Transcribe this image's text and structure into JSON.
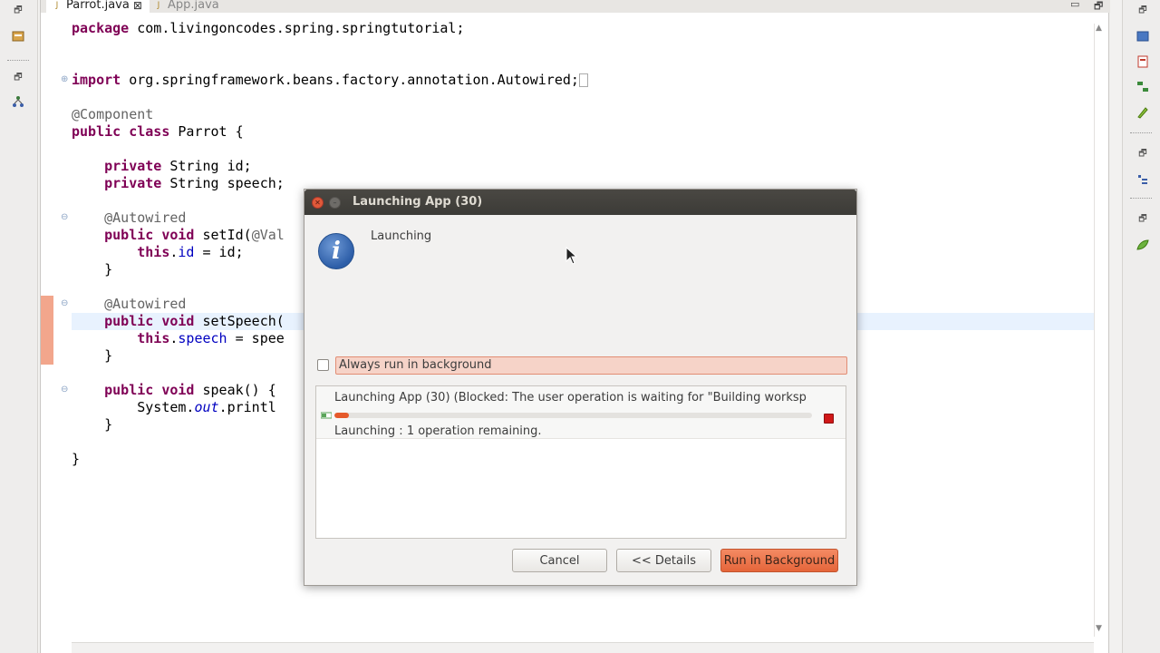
{
  "editor": {
    "tabs": [
      {
        "label": "Parrot.java",
        "active": true
      },
      {
        "label": "App.java",
        "active": false
      }
    ],
    "close_glyph": "⊠",
    "code_lines": {
      "package": "com.livingoncodes.spring.springtutorial;",
      "import": "org.springframework.beans.factory.annotation.Autowired;",
      "ann_component": "@Component",
      "class_name": "Parrot {",
      "field_id": "String id;",
      "field_speech": "String speech;",
      "ann_autowired1": "@Autowired",
      "set_id_sig": "setId(",
      "set_id_param": "@Val",
      "this_id": "this",
      "this_id_rest_a": ".",
      "this_id_field": "id",
      "this_id_rest_b": " = id;",
      "close1": "}",
      "ann_autowired2": "@Autowired",
      "set_speech_sig": "setSpeech(",
      "this_speech": "this",
      "this_speech_dot": ".",
      "this_speech_field": "speech",
      "this_speech_rest": " = spee",
      "close2": "}",
      "speak_sig": "speak() {",
      "sysout_a": "System.",
      "sysout_out": "out",
      "sysout_b": ".printl",
      "close3": "}",
      "close_class": "}"
    },
    "keywords": {
      "package": "package",
      "import": "import",
      "public": "public",
      "class": "class",
      "private": "private",
      "void": "void"
    }
  },
  "dialog": {
    "title": "Launching App (30)",
    "heading": "Launching",
    "always_background_label": "Always run in background",
    "always_background_checked": false,
    "operation": {
      "title": "Launching App (30) (Blocked: The user operation is waiting for \"Building worksp",
      "status": "Launching : 1 operation remaining.",
      "progress_fraction": 0.03
    },
    "buttons": {
      "cancel": "Cancel",
      "details": "<< Details",
      "run_background": "Run in Background"
    }
  },
  "colors": {
    "keyword": "#7f0055",
    "annotation": "#646464",
    "field": "#0000c0",
    "accent": "#e5653a",
    "titlebar": "#3c3b37"
  }
}
